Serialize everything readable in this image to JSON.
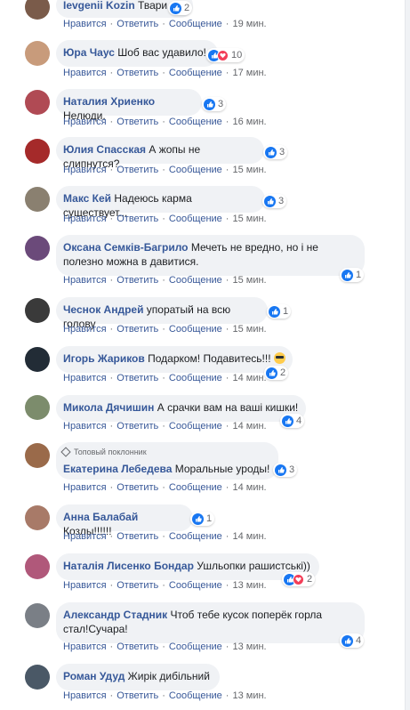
{
  "actions": {
    "like": "Нравится",
    "reply": "Ответить",
    "message": "Сообщение",
    "dot": "·"
  },
  "badge": "Топовый поклонник",
  "comments": [
    {
      "author": "Ievgenii Kozin",
      "text": "Твари.",
      "time": "19 мин.",
      "reactions": [
        "like"
      ],
      "count": "2"
    },
    {
      "author": "Юра Чаус",
      "text": "Шоб вас удавило!",
      "time": "17 мин.",
      "reactions": [
        "like",
        "love"
      ],
      "count": "10"
    },
    {
      "author": "Наталия Хриенко",
      "text": "Нелюди.",
      "time": "16 мин.",
      "reactions": [
        "like"
      ],
      "count": "3"
    },
    {
      "author": "Юлия Спасская",
      "text": "А жопы не слипнутся?",
      "time": "15 мин.",
      "reactions": [
        "like"
      ],
      "count": "3"
    },
    {
      "author": "Макс Кей",
      "text": "Надеюсь карма существует...",
      "time": "15 мин.",
      "reactions": [
        "like"
      ],
      "count": "3"
    },
    {
      "author": "Оксана Семків-Багрило",
      "text_line1": "Мечеть не вредно, но і не",
      "text_line2": "полезно можна в давитися.",
      "time": "15 мин.",
      "reactions": [
        "like"
      ],
      "count": "1"
    },
    {
      "author": "Чеснок Андрей",
      "text": "упоратый на всю голову",
      "time": "15 мин.",
      "reactions": [
        "like"
      ],
      "count": "1"
    },
    {
      "author": "Игорь Жариков",
      "text": "Подарком! Подавитесь!!!",
      "time": "14 мин.",
      "reactions": [
        "like"
      ],
      "count": "2"
    },
    {
      "author": "Микола Дячишин",
      "text": "А срачки вам на ваші кишки!",
      "time": "14 мин.",
      "reactions": [
        "like"
      ],
      "count": "4"
    },
    {
      "author": "Екатерина Лебедева",
      "text": "Моральные уроды!",
      "time": "14 мин.",
      "reactions": [
        "like"
      ],
      "count": "3"
    },
    {
      "author": "Анна Балабай",
      "text": "Козлы!!!!!!",
      "time": "14 мин.",
      "reactions": [
        "like"
      ],
      "count": "1"
    },
    {
      "author": "Наталія Лисенко Бондар",
      "text": "Ушльопки рашистські))",
      "time": "13 мин.",
      "reactions": [
        "like",
        "love"
      ],
      "count": "2"
    },
    {
      "author": "Александр Стадник",
      "text_line1": "Чтоб тебе кусок поперёк горла",
      "text_line2": "стал!Сучара!",
      "time": "13 мин.",
      "reactions": [
        "like"
      ],
      "count": "4"
    },
    {
      "author": "Роман Удуд",
      "text": "Жирік дибільний",
      "time": "13 мин.",
      "reactions": [],
      "count": ""
    }
  ],
  "colors": {
    "link": "#365899",
    "bubble": "#f0f2f5",
    "like": "#1877f2",
    "love": "#f33e58",
    "meta": "#65676b"
  }
}
